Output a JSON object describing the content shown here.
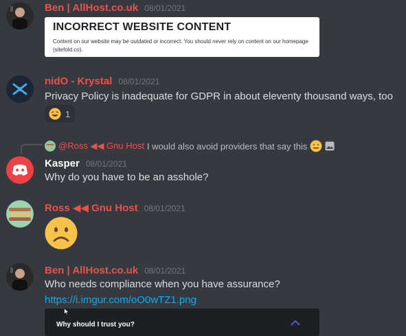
{
  "messages": [
    {
      "author": "Ben | AllHost.co.uk",
      "timestamp": "08/01/2021",
      "embed": {
        "title": "INCORRECT WEBSITE CONTENT",
        "description": "Content on our website may be outdated or incorrect. You should never rely on content on our homepage (sitefold.co)."
      }
    },
    {
      "author": "nidO - Krystal",
      "timestamp": "08/01/2021",
      "text": "Privacy Policy is inadequate for GDPR in about eleventy thousand ways, too",
      "reaction": {
        "emoji": "laughing-emoji",
        "count": "1"
      }
    },
    {
      "reply_to": {
        "author": "@Ross ◀◀ Gnu Host",
        "text": "I would also avoid providers that say this"
      },
      "author": "Kasper",
      "timestamp": "08/01/2021",
      "text": "Why do you have to be an asshole?"
    },
    {
      "author": "Ross ◀◀ Gnu Host",
      "timestamp": "08/01/2021",
      "content": "frowning-emoji"
    },
    {
      "author": "Ben | AllHost.co.uk",
      "timestamp": "08/01/2021",
      "text": "Who needs compliance when you have assurance?",
      "link": "https://i.imgur.com/oO0wTZ1.png",
      "embed": {
        "question": "Why should I trust you?"
      }
    }
  ],
  "colors": {
    "background": "#36393f",
    "username_red": "#e9524a",
    "timestamp": "#72767d",
    "link": "#00aff4"
  }
}
